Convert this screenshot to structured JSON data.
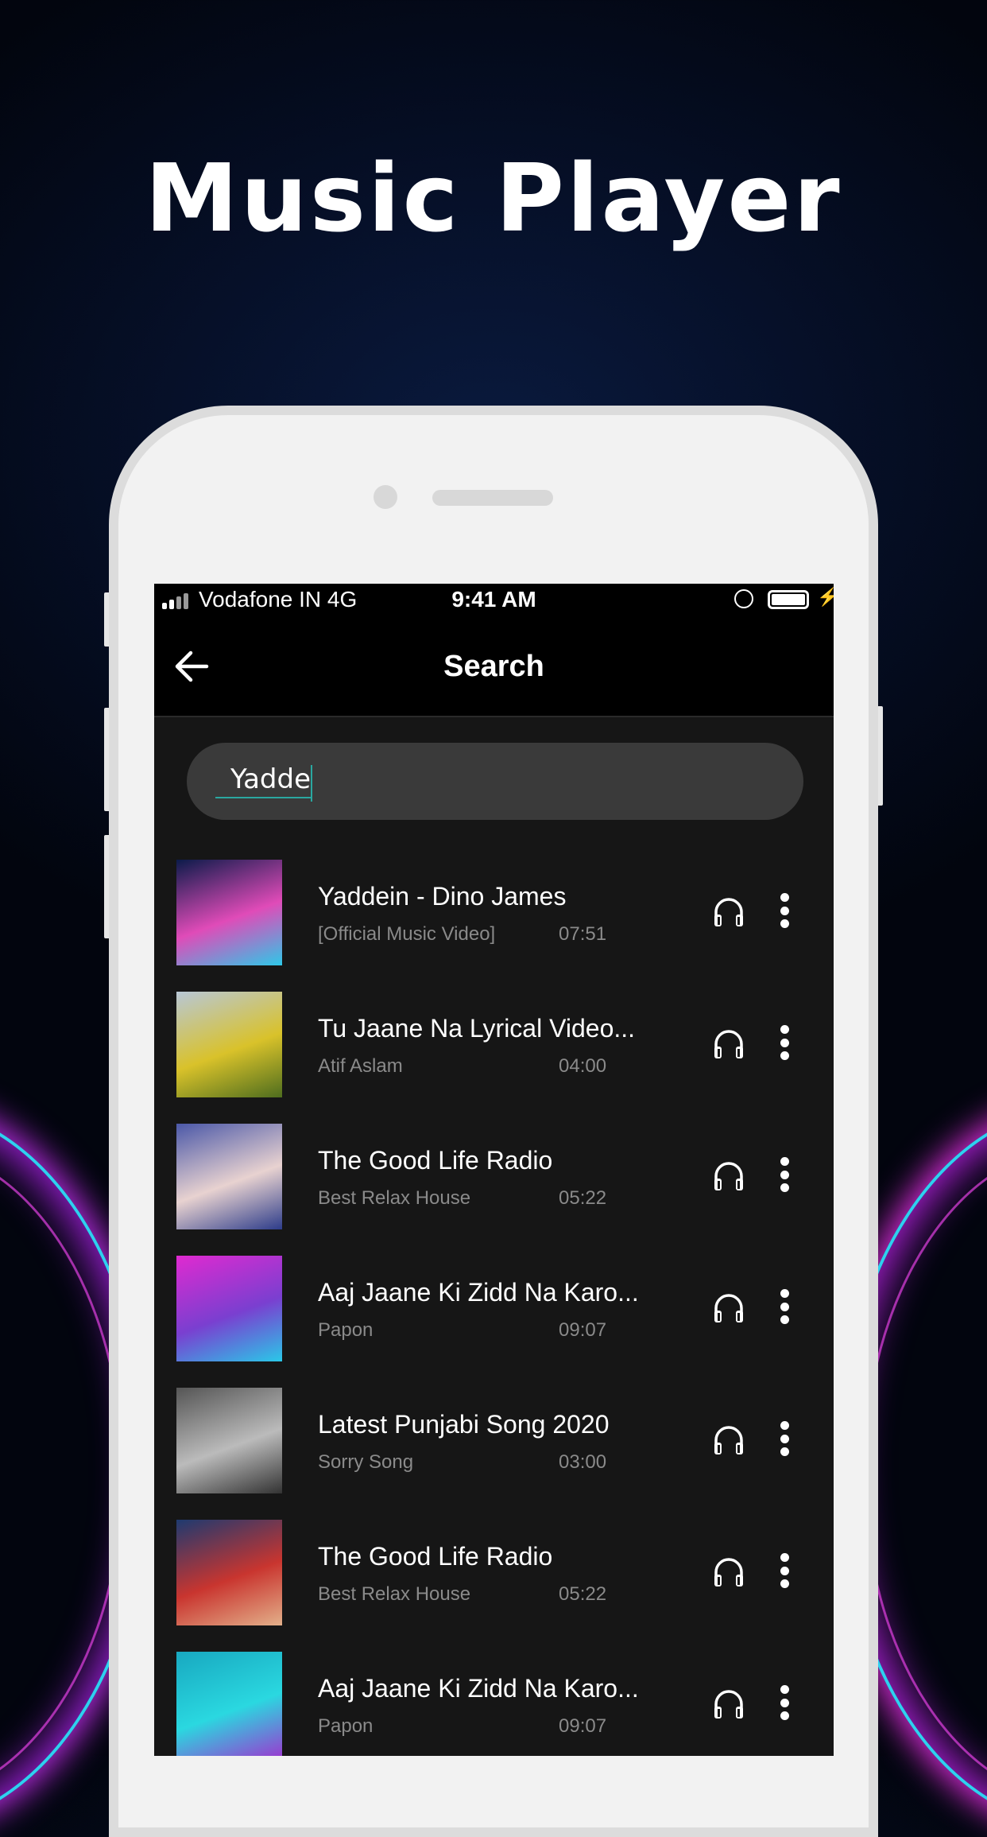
{
  "promo": {
    "title": "Music Player"
  },
  "status_bar": {
    "carrier": "Vodafone IN 4G",
    "time": "9:41 AM",
    "lock_glyph": "🔒",
    "bolt_glyph": "⚡"
  },
  "header": {
    "title": "Search",
    "back_icon": "arrow-left-icon"
  },
  "search": {
    "value": "Yadde",
    "accent_color": "#2aa7a0"
  },
  "songs": [
    {
      "title": "Yaddein - Dino James",
      "subtitle": "[Official Music Video]",
      "duration": "07:51",
      "thumb_colors": [
        "#0b1b4a",
        "#e04bb8",
        "#2ec8e8"
      ]
    },
    {
      "title": "Tu Jaane Na Lyrical Video...",
      "subtitle": "Atif Aslam",
      "duration": "04:00",
      "thumb_colors": [
        "#b8c7d6",
        "#d9c22a",
        "#4e6d1e"
      ]
    },
    {
      "title": "The Good Life Radio",
      "subtitle": "Best Relax House",
      "duration": "05:22",
      "thumb_colors": [
        "#4b58a8",
        "#e8d2d0",
        "#2d3c8a"
      ]
    },
    {
      "title": "Aaj Jaane Ki Zidd Na Karo...",
      "subtitle": "Papon",
      "duration": "09:07",
      "thumb_colors": [
        "#e02ad0",
        "#7a3fd0",
        "#2ac8e8"
      ]
    },
    {
      "title": "Latest Punjabi Song 2020",
      "subtitle": "Sorry Song",
      "duration": "03:00",
      "thumb_colors": [
        "#555555",
        "#bbbbbb",
        "#333333"
      ]
    },
    {
      "title": "The Good Life Radio",
      "subtitle": "Best Relax House",
      "duration": "05:22",
      "thumb_colors": [
        "#1e3a70",
        "#c9352f",
        "#e3b08a"
      ]
    },
    {
      "title": "Aaj Jaane Ki Zidd Na Karo...",
      "subtitle": "Papon",
      "duration": "09:07",
      "thumb_colors": [
        "#18a8c0",
        "#2ad8e0",
        "#9a3ad0"
      ]
    }
  ]
}
